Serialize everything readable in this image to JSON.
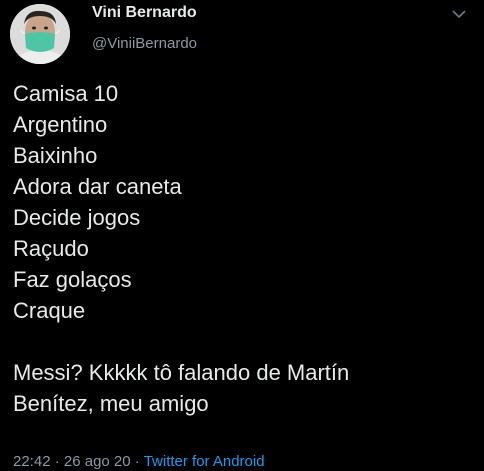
{
  "author": {
    "display_name": "Vini Bernardo",
    "handle": "@ViniiBernardo",
    "avatar_icon": "profile-photo-with-green-mask"
  },
  "more_icon": "chevron-down-icon",
  "tweet": {
    "lines": [
      "Camisa 10",
      "Argentino",
      "Baixinho",
      "Adora dar caneta",
      "Decide jogos",
      "Raçudo",
      "Faz golaços",
      "Craque"
    ],
    "paragraph_2": [
      "Messi? Kkkkk tô falando de Martín",
      "Benítez, meu amigo"
    ]
  },
  "meta": {
    "time": "22:42",
    "separator": " · ",
    "date": "26 ago 20",
    "source": "Twitter for Android"
  },
  "colors": {
    "background": "#000000",
    "text": "#e7e9ea",
    "secondary": "#8b98a5",
    "link": "#1d9bf0"
  }
}
